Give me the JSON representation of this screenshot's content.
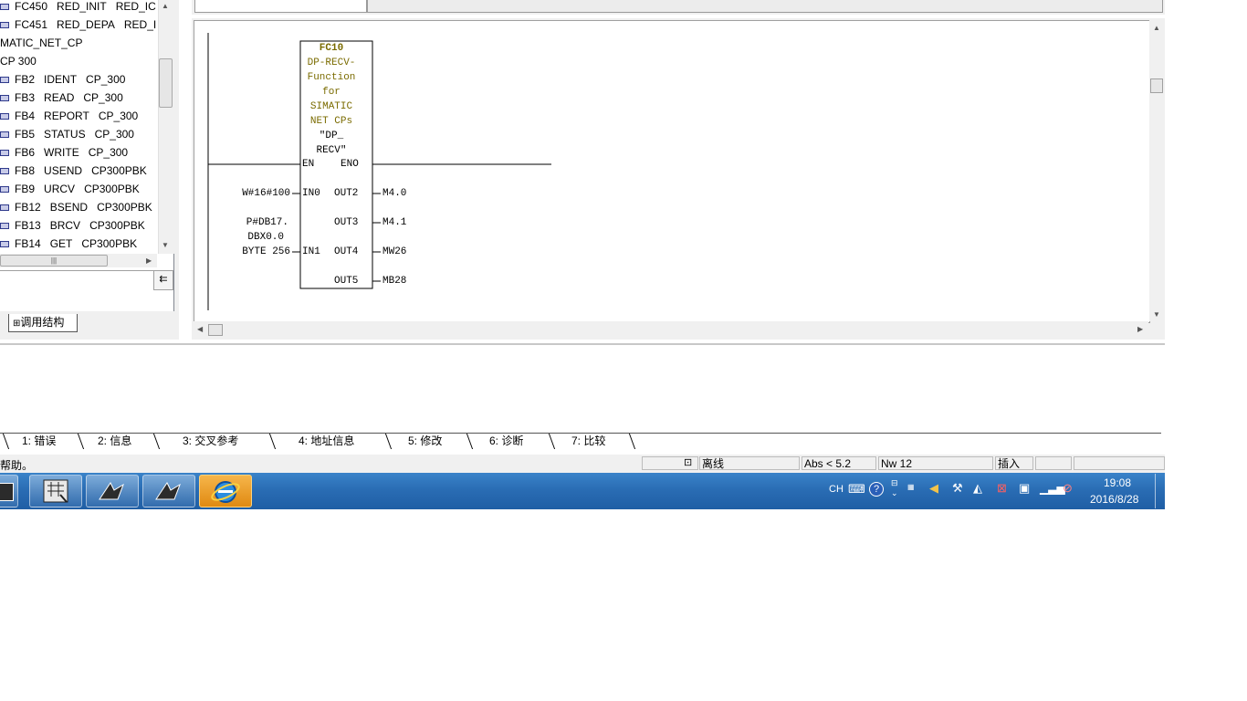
{
  "tree": {
    "items": [
      {
        "name": "FC450",
        "title": "RED_INIT",
        "family": "RED_IC",
        "block": true
      },
      {
        "name": "FC451",
        "title": "RED_DEPA",
        "family": "RED_I",
        "block": true
      },
      {
        "name": "MATIC_NET_CP",
        "title": "",
        "family": "",
        "block": false
      },
      {
        "name": "CP 300",
        "title": "",
        "family": "",
        "block": false
      },
      {
        "name": "FB2",
        "title": "IDENT",
        "family": "CP_300",
        "block": true
      },
      {
        "name": "FB3",
        "title": "READ",
        "family": "CP_300",
        "block": true
      },
      {
        "name": "FB4",
        "title": "REPORT",
        "family": "CP_300",
        "block": true
      },
      {
        "name": "FB5",
        "title": "STATUS",
        "family": "CP_300",
        "block": true
      },
      {
        "name": "FB6",
        "title": "WRITE",
        "family": "CP_300",
        "block": true
      },
      {
        "name": "FB8",
        "title": "USEND",
        "family": "CP300PBK",
        "block": true
      },
      {
        "name": "FB9",
        "title": "URCV",
        "family": "CP300PBK",
        "block": true
      },
      {
        "name": "FB12",
        "title": "BSEND",
        "family": "CP300PBK",
        "block": true
      },
      {
        "name": "FB13",
        "title": "BRCV",
        "family": "CP300PBK",
        "block": true
      },
      {
        "name": "FB14",
        "title": "GET",
        "family": "CP300PBK",
        "block": true
      }
    ],
    "corner_button": "⇇",
    "tab_label": "调用结构"
  },
  "block": {
    "name": "FC10",
    "description": [
      "DP-RECV-",
      "Function",
      "for",
      "SIMATIC",
      "NET CPs"
    ],
    "symbol": [
      "\"DP_",
      "RECV\""
    ],
    "en": "EN",
    "eno": "ENO",
    "in0": "IN0",
    "in1": "IN1",
    "out2": "OUT2",
    "out3": "OUT3",
    "out4": "OUT4",
    "out5": "OUT5",
    "in0_param": "W#16#100",
    "in1_param": [
      "P#DB17.",
      "DBX0.0",
      "BYTE 256"
    ],
    "out2_param": "M4.0",
    "out3_param": "M4.1",
    "out4_param": "MW26",
    "out5_param": "MB28"
  },
  "output_tabs": [
    "1: 错误",
    "2: 信息",
    "3: 交叉参考",
    "4: 地址信息",
    "5: 修改",
    "6: 诊断",
    "7: 比较"
  ],
  "status": {
    "help": "帮助。",
    "mode": "离线",
    "abs": "Abs < 5.2",
    "nw": "Nw 12",
    "insert": "插入"
  },
  "taskbar": {
    "lang": "CH",
    "time": "19:08",
    "date": "2016/8/28"
  }
}
